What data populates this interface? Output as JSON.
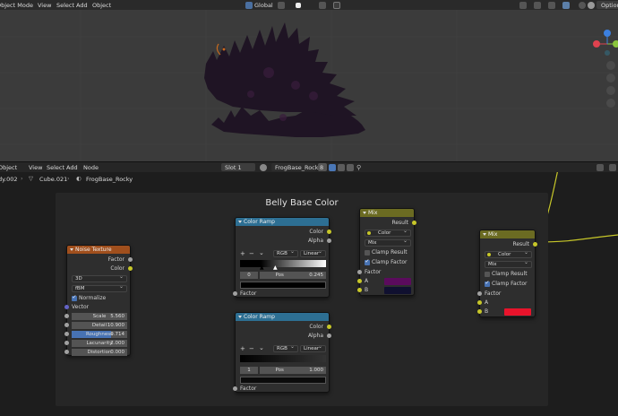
{
  "viewport": {
    "header": {
      "mode": "Object Mode",
      "menu": [
        "View",
        "Select",
        "Add",
        "Object"
      ],
      "transform_orientation": "Global",
      "options_label": "Options"
    },
    "gizmo_colors": {
      "x": "#e0424f",
      "y": "#8bc53c",
      "z": "#3c80e0"
    }
  },
  "node_editor": {
    "header": {
      "mode": "Object",
      "menu": [
        "View",
        "Select",
        "Add",
        "Node"
      ],
      "slot": "Slot 1",
      "material": "FrogBase_Rocky",
      "user_count": "8"
    },
    "breadcrumb": {
      "object": "dy.002",
      "mesh": "Cube.021",
      "material": "FrogBase_Rocky"
    },
    "frame_title": "Belly Base Color",
    "noise_node": {
      "title": "Noise Texture",
      "outputs": [
        "Factor",
        "Color"
      ],
      "dimensions": "3D",
      "type": "fBM",
      "normalize_label": "Normalize",
      "vector_label": "Vector",
      "params": [
        {
          "label": "Scale",
          "value": "5.560"
        },
        {
          "label": "Detail",
          "value": "10.900"
        },
        {
          "label": "Roughness",
          "value": "0.714"
        },
        {
          "label": "Lacunarity",
          "value": "2.000"
        },
        {
          "label": "Distortion",
          "value": "0.000"
        }
      ],
      "roughness_fill": 0.714
    },
    "ramp1": {
      "title": "Color Ramp",
      "outputs": [
        "Color",
        "Alpha"
      ],
      "color_mode": "RGB",
      "interpolation": "Linear",
      "index": "0",
      "pos_label": "Pos",
      "pos_value": "0.245",
      "input": "Factor"
    },
    "ramp2": {
      "title": "Color Ramp",
      "outputs": [
        "Color",
        "Alpha"
      ],
      "color_mode": "RGB",
      "interpolation": "Linear",
      "index": "1",
      "pos_label": "Pos",
      "pos_value": "1.000",
      "input": "Factor"
    },
    "mix1": {
      "title": "Mix",
      "output": "Result",
      "data_type": "Color",
      "blend": "Mix",
      "clamp_result": "Clamp Result",
      "clamp_factor": "Clamp Factor",
      "inputs": [
        "Factor",
        "A",
        "B"
      ],
      "color_a": "#5b0b5d",
      "color_b": "#101030"
    },
    "mix2": {
      "title": "Mix",
      "output": "Result",
      "data_type": "Color",
      "blend": "Mix",
      "clamp_result": "Clamp Result",
      "clamp_factor": "Clamp Factor",
      "inputs": [
        "Factor",
        "A",
        "B"
      ],
      "color_b": "#e8132b"
    }
  }
}
